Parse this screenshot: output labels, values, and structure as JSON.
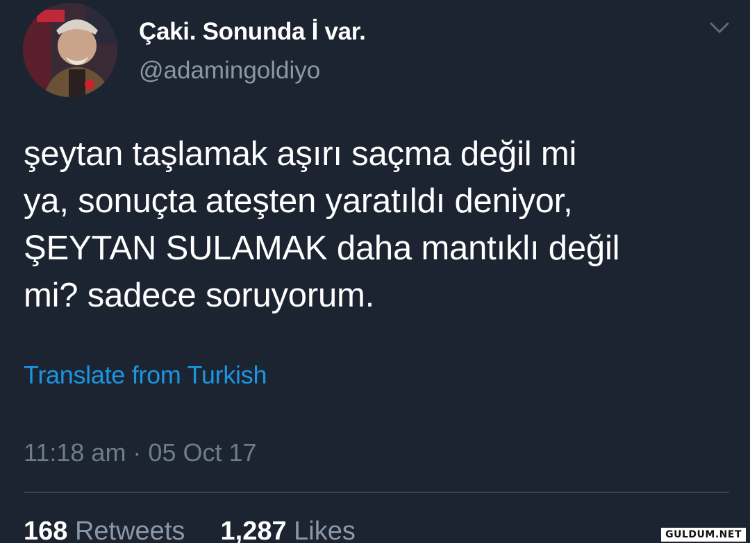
{
  "tweet": {
    "display_name": "Çaki. Sonunda İ var.",
    "handle": "@adamingoldiyo",
    "menu_icon": "chevron-down-icon",
    "text_lines": [
      "şeytan taşlamak aşırı saçma değil mi",
      "ya, sonuçta ateşten yaratıldı deniyor,",
      "ŞEYTAN SULAMAK daha mantıklı değil",
      "mi? sadece soruyorum."
    ],
    "translate_label": "Translate from Turkish",
    "timestamp": "11:18 am · 05 Oct 17",
    "retweets": {
      "count": "168",
      "label": "Retweets"
    },
    "likes": {
      "count": "1,287",
      "label": "Likes"
    }
  },
  "watermark": "GULDUM.NET",
  "colors": {
    "background": "#1c2431",
    "link": "#1b95e0",
    "secondary_text": "#8b98a5",
    "divider": "#38444d"
  }
}
